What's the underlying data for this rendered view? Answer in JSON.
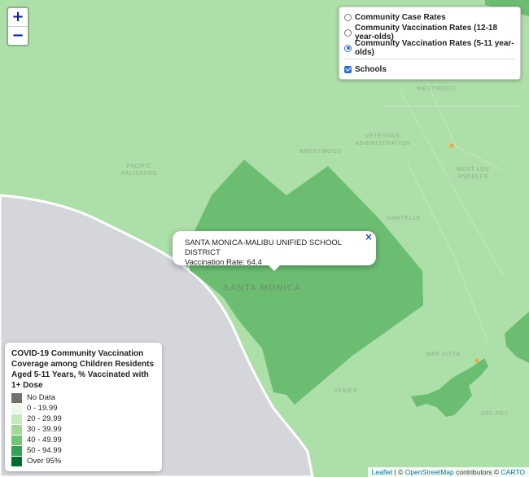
{
  "map": {
    "places": {
      "westwood": "WESTWOOD",
      "veterans_admin": "VETERANS ADMINISTRATION",
      "brentwood": "BRENTWOOD",
      "pacific_palisades": "PACIFIC PALISADES",
      "west_la": "WEST LOS ANGELES",
      "sawtelle": "SAWTELLE",
      "santa_monica": "SANTA MONICA",
      "mar_vista": "MAR VISTA",
      "venice": "VENICE",
      "del_rey": "DEL REY"
    },
    "colors": {
      "ocean": "#d4d6da",
      "base_fill": "#addfa8",
      "selected_fill": "#6bbd72",
      "darker_fill": "#4ea95b",
      "school_marker": "#f0a93a"
    }
  },
  "zoom": {
    "in_label": "+",
    "out_label": "−"
  },
  "layers": {
    "options": [
      {
        "label": "Community Case Rates",
        "selected": false
      },
      {
        "label": "Community Vaccination Rates (12-18 year-olds)",
        "selected": false
      },
      {
        "label": "Community Vaccination Rates (5-11 year-olds)",
        "selected": true
      }
    ],
    "overlay": {
      "label": "Schools",
      "checked": true
    }
  },
  "popup": {
    "line1": "SANTA MONICA-MALIBU UNIFIED SCHOOL DISTRICT",
    "line2": "Vaccination Rate: 64.4",
    "close": "×"
  },
  "legend": {
    "title": "COVID-19 Community Vaccination Coverage among Children Residents Aged 5-11 Years, % Vaccinated with 1+ Dose",
    "items": [
      {
        "label": "No Data",
        "color": "#707070"
      },
      {
        "label": "0 - 19.99",
        "color": "#edf8e9"
      },
      {
        "label": "20 - 29.99",
        "color": "#c7e9c0"
      },
      {
        "label": "30 - 39.99",
        "color": "#a1d99b"
      },
      {
        "label": "40 - 49.99",
        "color": "#74c476"
      },
      {
        "label": "50 - 94.99",
        "color": "#31a354"
      },
      {
        "label": "Over 95%",
        "color": "#006d2c"
      }
    ]
  },
  "attribution": {
    "leaflet": "Leaflet",
    "sep": " | © ",
    "osm": "OpenStreetMap",
    "contributors": " contributors © ",
    "carto": "CARTO"
  }
}
